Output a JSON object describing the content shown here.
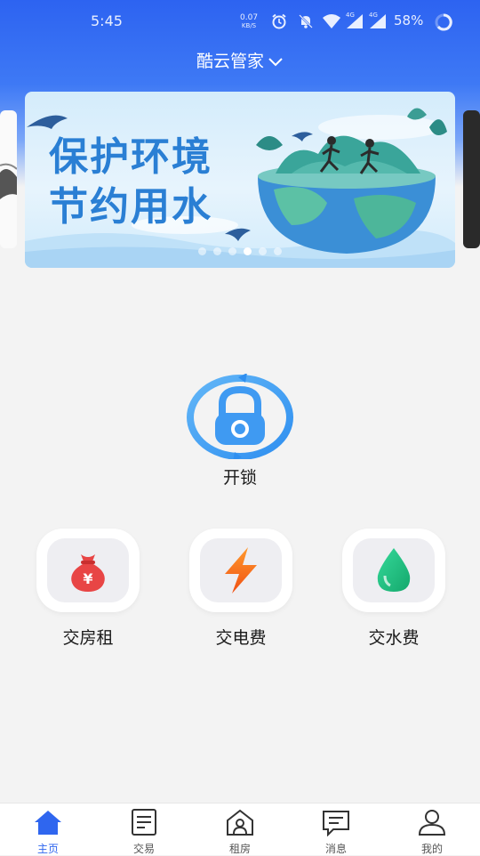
{
  "status_bar": {
    "time": "5:45",
    "net_speed": "0.07",
    "net_unit": "KB/S",
    "signal_1": "4G",
    "signal_2": "4G",
    "battery": "58%"
  },
  "header": {
    "title": "酷云管家"
  },
  "banner": {
    "line1": "保护环境",
    "line2": "节约用水",
    "slide_count": 6,
    "active_slide": 4
  },
  "unlock": {
    "label": "开锁"
  },
  "services": [
    {
      "label": "交房租",
      "icon": "money-bag-icon",
      "color": "#e84545"
    },
    {
      "label": "交电费",
      "icon": "lightning-icon",
      "color": "#f06a1a"
    },
    {
      "label": "交水费",
      "icon": "water-drop-icon",
      "color": "#1fb97a"
    }
  ],
  "tabs": [
    {
      "label": "主页",
      "icon": "home-icon",
      "active": true
    },
    {
      "label": "交易",
      "icon": "transaction-icon",
      "active": false
    },
    {
      "label": "租房",
      "icon": "rent-house-icon",
      "active": false
    },
    {
      "label": "消息",
      "icon": "message-icon",
      "active": false
    },
    {
      "label": "我的",
      "icon": "profile-icon",
      "active": false
    }
  ],
  "colors": {
    "primary": "#2f66ef",
    "header": "#2d63f1",
    "background": "#f3f3f3"
  }
}
